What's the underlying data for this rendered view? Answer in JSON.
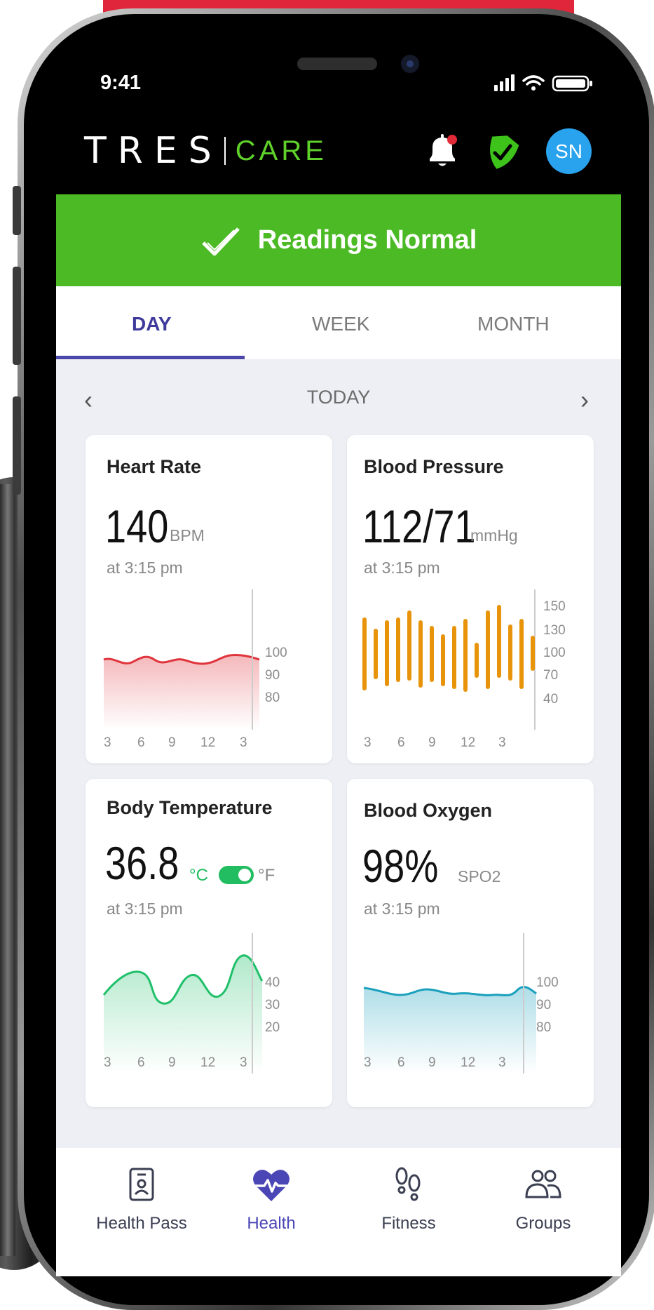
{
  "status_bar": {
    "time": "9:41"
  },
  "header": {
    "logo_main": "TRES",
    "logo_sub": "CARE",
    "avatar_initials": "SN"
  },
  "banner": {
    "text": "Readings Normal",
    "color": "#4cba24"
  },
  "tabs": [
    {
      "label": "DAY",
      "active": true
    },
    {
      "label": "WEEK",
      "active": false
    },
    {
      "label": "MONTH",
      "active": false
    }
  ],
  "date_nav": {
    "label": "TODAY"
  },
  "cards": [
    {
      "title": "Heart Rate",
      "value": "140",
      "unit": "BPM",
      "time": "at 3:15 pm"
    },
    {
      "title": "Blood Pressure",
      "value": "112/71",
      "unit": "mmHg",
      "time": "at 3:15 pm"
    },
    {
      "title": "Body Temperature",
      "value": "36.8",
      "unit_c": "°C",
      "unit_f": "°F",
      "time": "at 3:15 pm"
    },
    {
      "title": "Blood Oxygen",
      "value": "98%",
      "unit": "SPO2",
      "time": "at 3:15 pm"
    }
  ],
  "chart_data": [
    {
      "type": "area",
      "title": "Heart Rate",
      "x": [
        "3",
        "6",
        "9",
        "12",
        "3"
      ],
      "y_ticks": [
        "100",
        "90",
        "80"
      ],
      "color": "#e0343c"
    },
    {
      "type": "bar",
      "title": "Blood Pressure",
      "x": [
        "3",
        "6",
        "9",
        "12",
        "3"
      ],
      "y_ticks": [
        "150",
        "130",
        "100",
        "70",
        "40"
      ],
      "color": "#e8940b"
    },
    {
      "type": "area",
      "title": "Body Temperature",
      "x": [
        "3",
        "6",
        "9",
        "12",
        "3"
      ],
      "y_ticks": [
        "40",
        "30",
        "20"
      ],
      "color": "#20c06a"
    },
    {
      "type": "area",
      "title": "Blood Oxygen",
      "x": [
        "3",
        "6",
        "9",
        "12",
        "3"
      ],
      "y_ticks": [
        "100",
        "90",
        "80"
      ],
      "color": "#1ba0bd"
    }
  ],
  "bottom_nav": [
    {
      "label": "Health Pass",
      "icon": "id-badge-icon",
      "active": false
    },
    {
      "label": "Health",
      "icon": "heart-pulse-icon",
      "active": true
    },
    {
      "label": "Fitness",
      "icon": "footprints-icon",
      "active": false
    },
    {
      "label": "Groups",
      "icon": "people-icon",
      "active": false
    }
  ]
}
